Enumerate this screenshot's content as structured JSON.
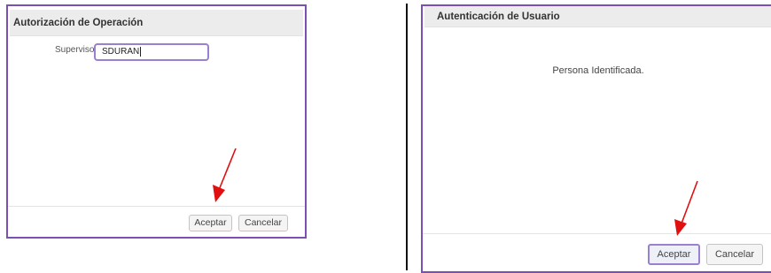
{
  "left_dialog": {
    "title": "Autorización de Operación",
    "supervisor_label": "Supervisor",
    "supervisor_value": "SDURAN",
    "accept_label": "Aceptar",
    "cancel_label": "Cancelar"
  },
  "right_dialog": {
    "title": "Autenticación de Usuario",
    "message": "Persona Identificada.",
    "accept_label": "Aceptar",
    "cancel_label": "Cancelar"
  },
  "colors": {
    "dialog_border": "#7b4fb3",
    "arrow": "#e01010",
    "focus_border": "#9b7fd0",
    "titlebar_bg": "#ececec"
  },
  "icons": [
    "red-arrow-annotation"
  ]
}
